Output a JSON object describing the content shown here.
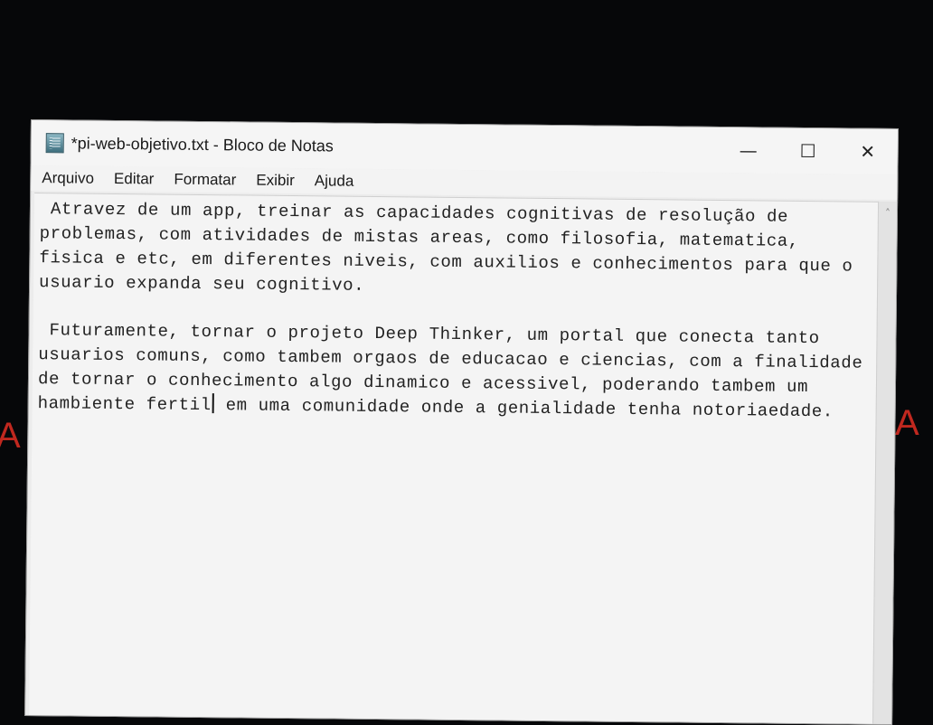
{
  "background": {
    "left_glyph": "A",
    "right_glyph": "A",
    "accent_color": "#c0281f"
  },
  "window": {
    "title": "*pi-web-objetivo.txt - Bloco de Notas",
    "icon": "notepad-icon",
    "controls": {
      "minimize": "—",
      "maximize": "☐",
      "close": "✕"
    }
  },
  "menu": [
    {
      "label": "Arquivo"
    },
    {
      "label": "Editar"
    },
    {
      "label": "Formatar"
    },
    {
      "label": "Exibir"
    },
    {
      "label": "Ajuda"
    }
  ],
  "document": {
    "paragraph_1": " Atravez de um app, treinar as capacidades cognitivas de resolução de problemas, com atividades de mistas areas, como filosofia, matematica, fisica e etc, em diferentes niveis, com auxilios e conhecimentos para que o usuario expanda seu cognitivo.",
    "paragraph_2_before_caret": " Futuramente, tornar o projeto Deep Thinker, um portal que conecta tanto usuarios comuns, como tambem orgaos de educacao e ciencias, com a finalidade de tornar o conhecimento algo dinamico e acessivel, poderando tambem um hambiente fertil",
    "paragraph_2_after_caret": " em uma comunidade onde a genialidade tenha notoriaedade."
  },
  "scrollbar": {
    "up_arrow": "˄"
  }
}
